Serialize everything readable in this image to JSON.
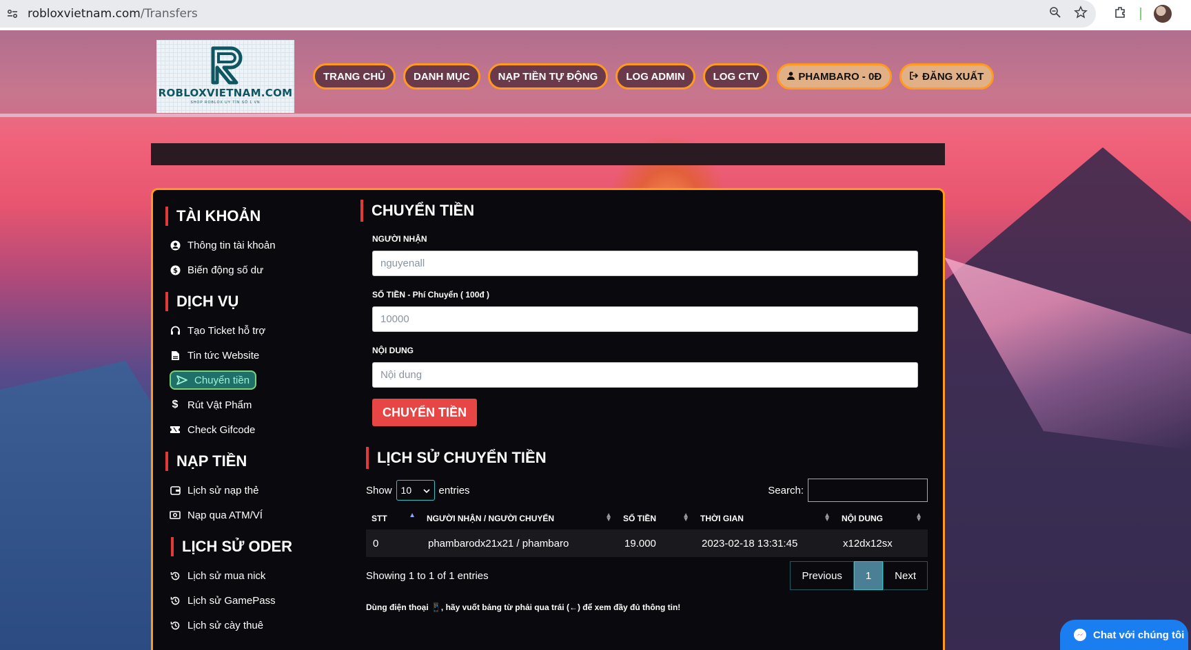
{
  "browser": {
    "url_domain": "robloxvietnam.com",
    "url_path": "/Transfers"
  },
  "logo": {
    "text": "ROBLOXVIETNAM.COM",
    "subtext": "SHOP ROBLOX UY TÍN SỐ 1 VN"
  },
  "nav": [
    {
      "label": "TRANG CHỦ"
    },
    {
      "label": "DANH MỤC"
    },
    {
      "label": "NẠP TIỀN TỰ ĐỘNG"
    },
    {
      "label": "LOG ADMIN"
    },
    {
      "label": "LOG CTV"
    },
    {
      "label": "PHAMBARO - 0Đ",
      "icon": "user-icon"
    },
    {
      "label": "ĐĂNG XUẤT",
      "icon": "logout-icon"
    }
  ],
  "sidebar": {
    "sections": [
      {
        "title": "TÀI KHOẢN",
        "items": [
          {
            "label": "Thông tin tài khoản",
            "icon": "user-circle-icon"
          },
          {
            "label": "Biến động số dư",
            "icon": "dollar-circle-icon"
          }
        ]
      },
      {
        "title": "DỊCH VỤ",
        "items": [
          {
            "label": "Tạo Ticket hỗ trợ",
            "icon": "headset-icon"
          },
          {
            "label": "Tin tức Website",
            "icon": "file-icon"
          },
          {
            "label": "Chuyển tiền",
            "icon": "send-icon",
            "active": true
          },
          {
            "label": "Rút Vật Phẩm",
            "icon": "dollar-icon"
          },
          {
            "label": "Check Gifcode",
            "icon": "ticket-icon"
          }
        ]
      },
      {
        "title": "NẠP TIỀN",
        "items": [
          {
            "label": "Lịch sử nạp thẻ",
            "icon": "wallet-icon"
          },
          {
            "label": "Nạp qua ATM/VÍ",
            "icon": "money-icon"
          }
        ]
      },
      {
        "title": "LỊCH SỬ ODER",
        "items": [
          {
            "label": "Lịch sử mua nick",
            "icon": "history-icon"
          },
          {
            "label": "Lịch sử GamePass",
            "icon": "history-icon"
          },
          {
            "label": "Lịch sử cày thuê",
            "icon": "history-icon"
          }
        ]
      }
    ]
  },
  "transfer": {
    "title": "CHUYỂN TIỀN",
    "recipient_label": "NGƯỜI NHẬN",
    "recipient_placeholder": "nguyenall",
    "amount_label": "SỐ TIỀN - Phí Chuyển ( 100đ )",
    "amount_placeholder": "10000",
    "note_label": "NỘI DUNG",
    "note_placeholder": "Nội dung",
    "submit_label": "CHUYỂN TIỀN"
  },
  "history": {
    "title": "LỊCH SỬ CHUYỂN TIỀN",
    "show_label": "Show",
    "entries_value": "10",
    "entries_label": "entries",
    "search_label": "Search:",
    "columns": [
      "STT",
      "NGƯỜI NHẬN / NGƯỜI CHUYỂN",
      "SỐ TIỀN",
      "THỜI GIAN",
      "NỘI DUNG"
    ],
    "rows": [
      {
        "stt": "0",
        "parties": "phambarodx21x21 / phambaro",
        "amount": "19.000",
        "time": "2023-02-18 13:31:45",
        "content": "x12dx12sx"
      }
    ],
    "info": "Showing 1 to 1 of 1 entries",
    "prev_label": "Previous",
    "page": "1",
    "next_label": "Next",
    "tip": "Dùng điện thoại 📱, hãy vuốt bảng từ phải qua trái (←) để xem đầy đủ thông tin!"
  },
  "chat": {
    "label": "Chat với chúng tôi"
  }
}
